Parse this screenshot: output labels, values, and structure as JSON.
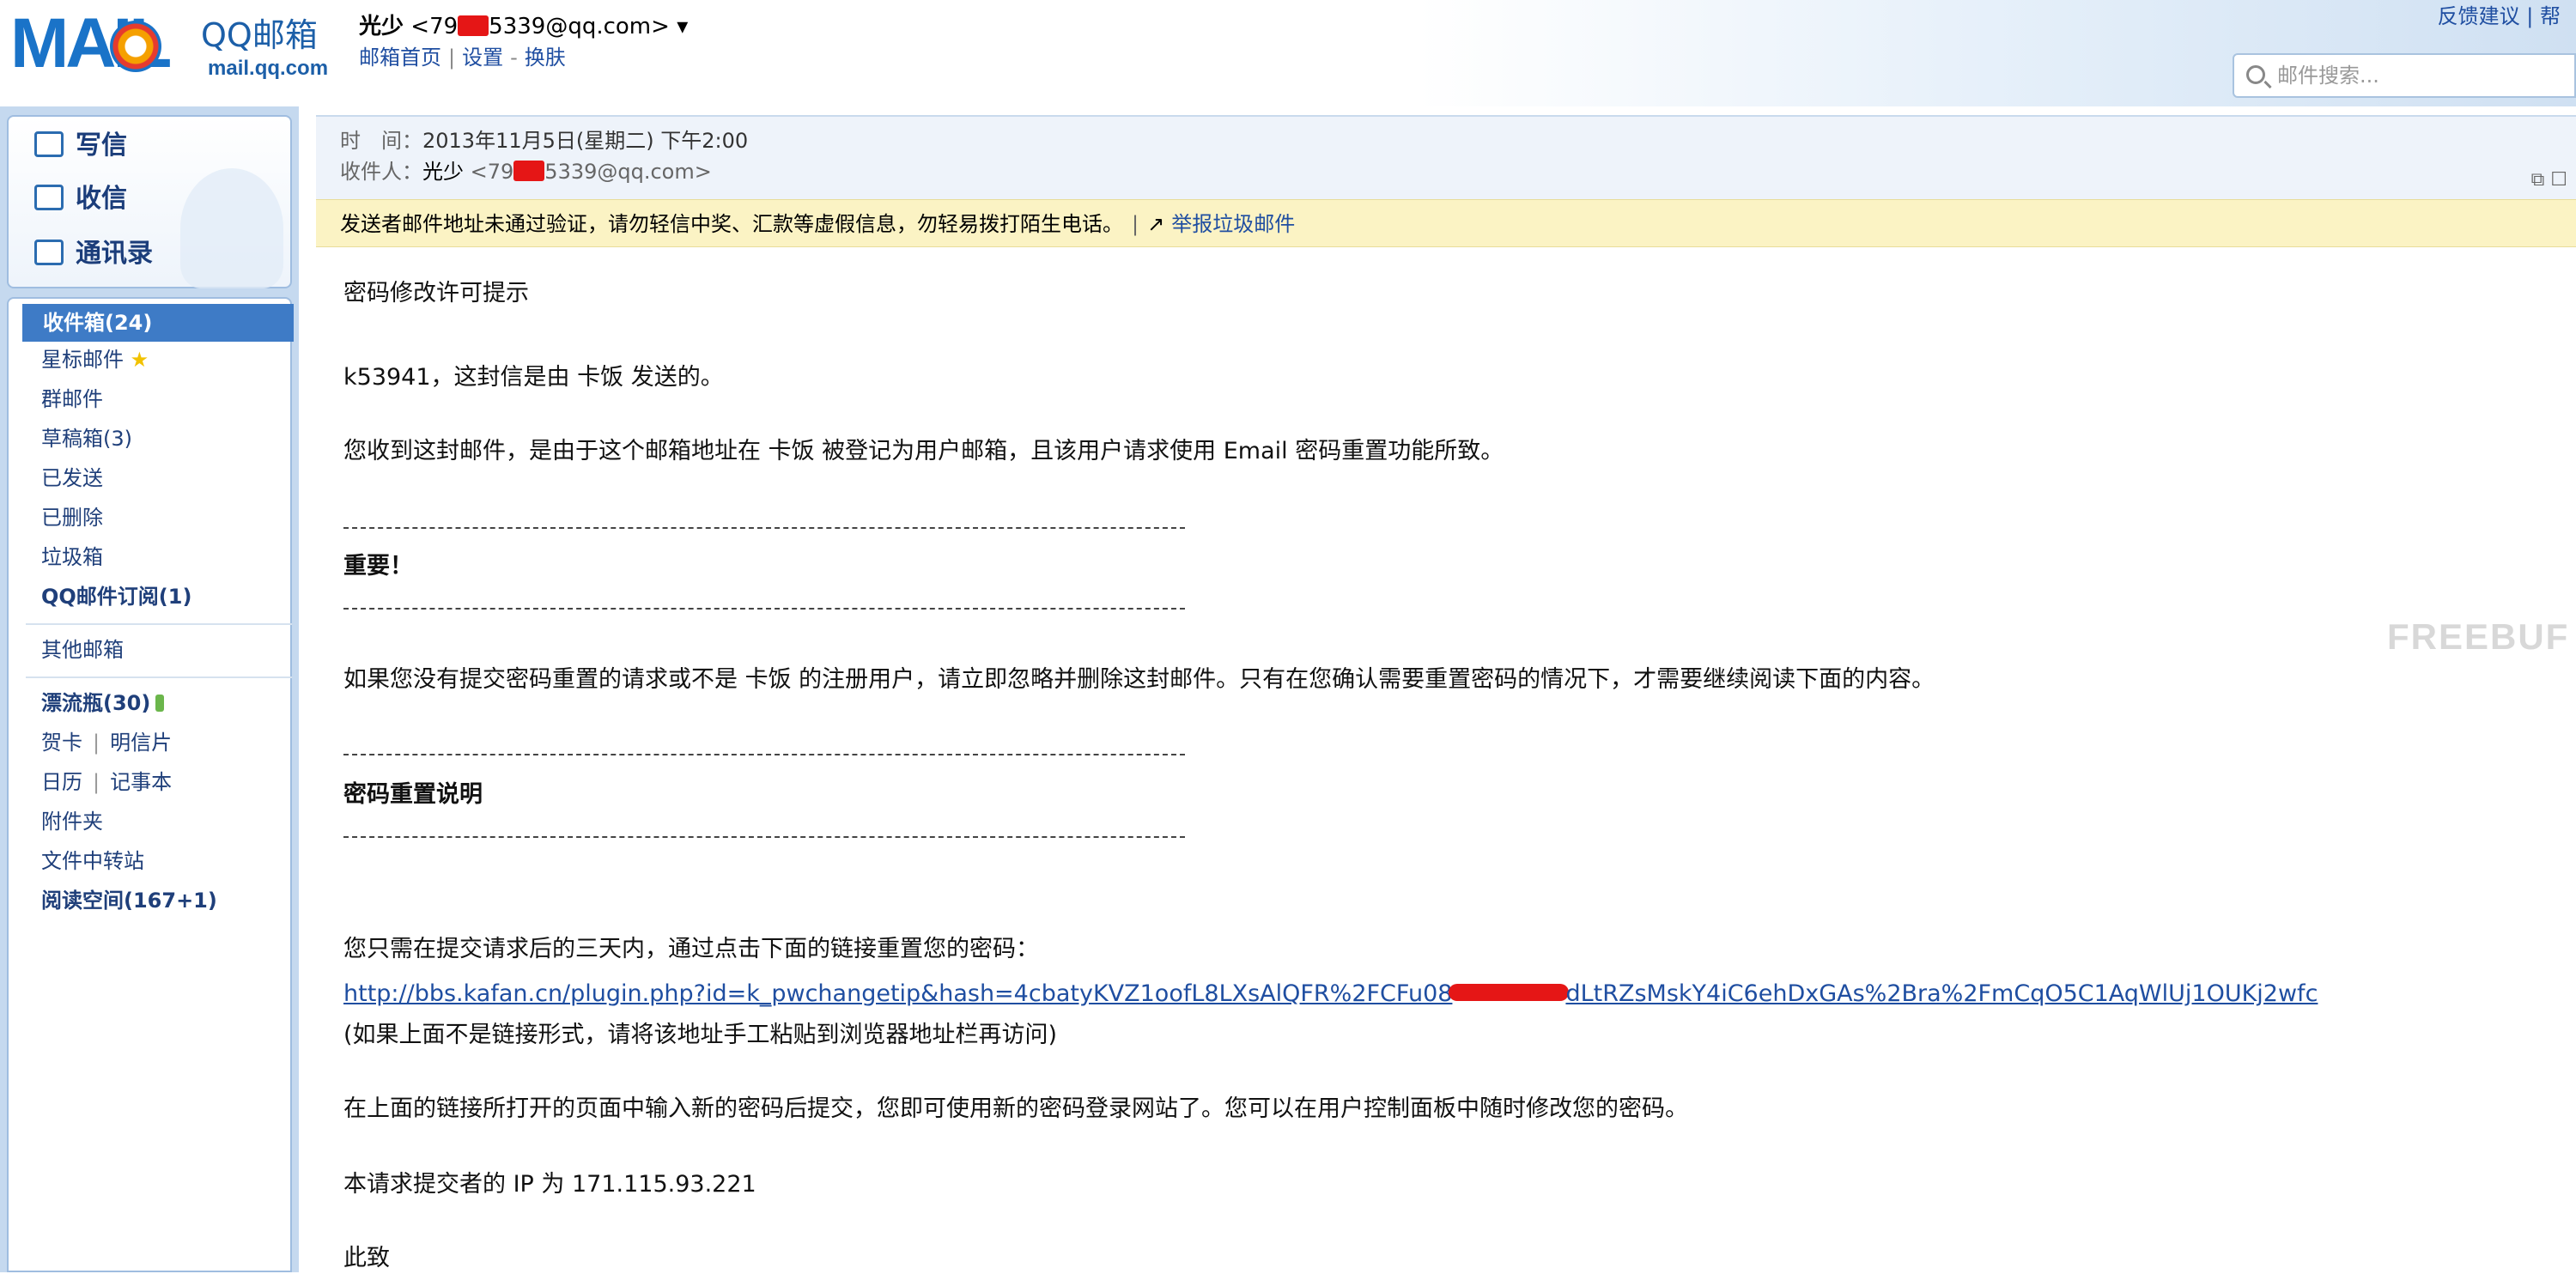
{
  "app": {
    "logo_text": "MAIL",
    "logo_name": "QQ邮箱",
    "logo_domain": "mail.qq.com"
  },
  "header": {
    "user_name": "光少",
    "user_email_prefix": "<79",
    "user_email_suffix": "5339@qq.com>",
    "dropdown_glyph": "▾",
    "nav": [
      "邮箱首页",
      "设置",
      "换肤"
    ],
    "feedback": "反馈建议 | 帮",
    "search_placeholder": "邮件搜索..."
  },
  "sidebar": {
    "actions": [
      "写信",
      "收信",
      "通讯录"
    ],
    "folders": {
      "inbox": "收件箱(24)",
      "starred": "星标邮件",
      "star_glyph": "★",
      "group": "群邮件",
      "drafts": "草稿箱(3)",
      "sent": "已发送",
      "deleted": "已删除",
      "spam": "垃圾箱",
      "subscriptions": "QQ邮件订阅(1)",
      "other": "其他邮箱",
      "bottle": "漂流瓶(30)",
      "cards": "贺卡",
      "postcards": "明信片",
      "calendar": "日历",
      "notes": "记事本",
      "attachments": "附件夹",
      "transfer": "文件中转站",
      "reading": "阅读空间(167+1)"
    }
  },
  "message": {
    "time_label": "时　间：",
    "time_value": "2013年11月5日(星期二) 下午2:00",
    "to_label": "收件人：",
    "to_name": "光少",
    "to_email_prefix": "<79",
    "to_email_suffix": "5339@qq.com>",
    "window_icons": "⧉ ☐",
    "warning": "发送者邮件地址未通过验证，请勿轻信中奖、汇款等虚假信息，勿轻易拨打陌生电话。",
    "report_link": "举报垃圾邮件",
    "body": {
      "title": "密码修改许可提示",
      "line1": "k53941，这封信是由 卡饭 发送的。",
      "line2": "您收到这封邮件，是由于这个邮箱地址在 卡饭 被登记为用户邮箱，且该用户请求使用 Email 密码重置功能所致。",
      "important": "重要！",
      "line3": "如果您没有提交密码重置的请求或不是 卡饭 的注册用户，请立即忽略并删除这封邮件。只有在您确认需要重置密码的情况下，才需要继续阅读下面的内容。",
      "reset_heading": "密码重置说明",
      "line4": "您只需在提交请求后的三天内，通过点击下面的链接重置您的密码：",
      "url_part1": "http://bbs.kafan.cn/plugin.php?id=k_pwchangetip&hash=4cbatyKVZ1oofL8LXsAlQFR%2FCFu08",
      "url_part2": "dLtRZsMskY4iC6ehDxGAs%2Bra%2FmCqO5C1AqWlUj1OUKj2wfc",
      "line5": "(如果上面不是链接形式，请将该地址手工粘贴到浏览器地址栏再访问)",
      "line6": "在上面的链接所打开的页面中输入新的密码后提交，您即可使用新的密码登录网站了。您可以在用户控制面板中随时修改您的密码。",
      "line7": "本请求提交者的 IP 为 171.115.93.221",
      "closing": "此致"
    }
  },
  "watermark": "FREEBUF"
}
